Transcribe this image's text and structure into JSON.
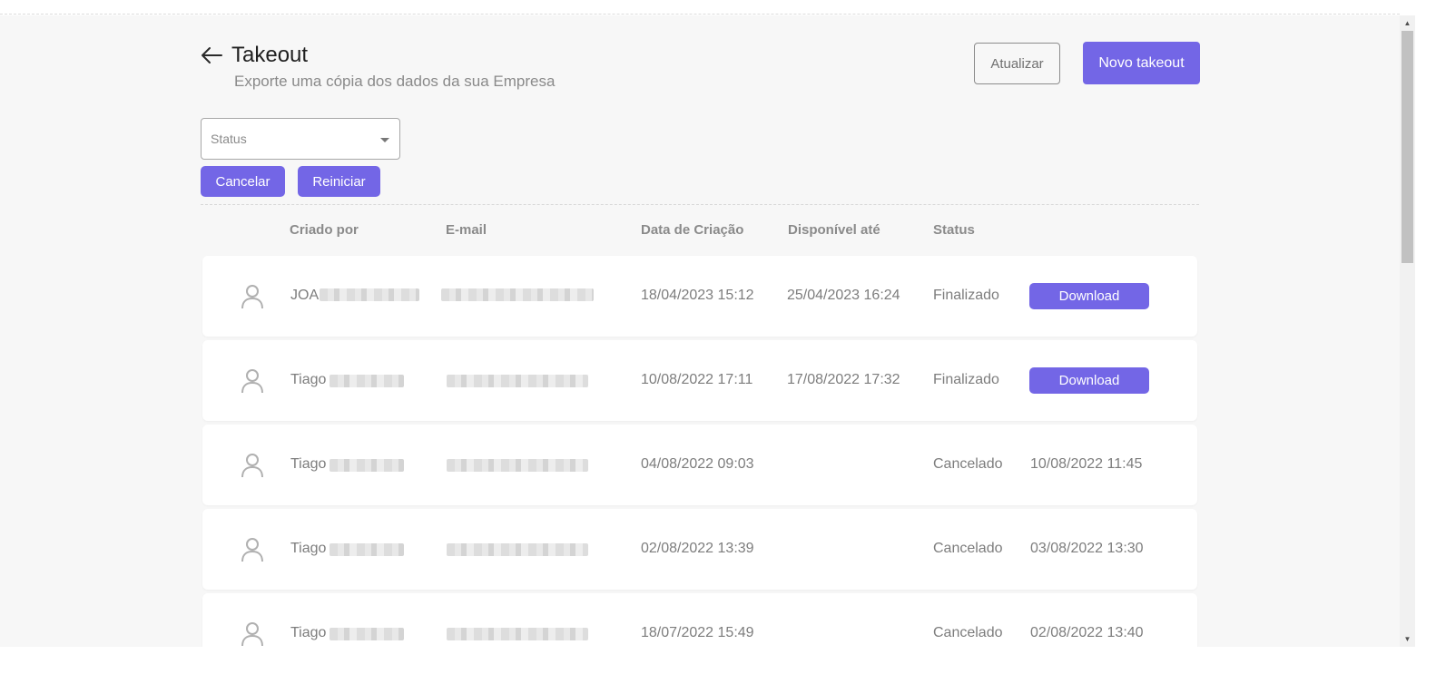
{
  "header": {
    "title": "Takeout",
    "subtitle": "Exporte uma cópia dos dados da sua Empresa"
  },
  "actions": {
    "refresh_label": "Atualizar",
    "new_label": "Novo takeout"
  },
  "filter": {
    "status_placeholder": "Status",
    "cancel_label": "Cancelar",
    "reset_label": "Reiniciar"
  },
  "columns": {
    "created_by": "Criado por",
    "email": "E-mail",
    "created_at": "Data de Criação",
    "available_until": "Disponível até",
    "status": "Status"
  },
  "rows": [
    {
      "name": "JOA",
      "created_at": "18/04/2023 15:12",
      "available_until": "25/04/2023 16:24",
      "status": "Finalizado",
      "action": "Download",
      "extra": ""
    },
    {
      "name": "Tiago",
      "created_at": "10/08/2022 17:11",
      "available_until": "17/08/2022 17:32",
      "status": "Finalizado",
      "action": "Download",
      "extra": ""
    },
    {
      "name": "Tiago",
      "created_at": "04/08/2022 09:03",
      "available_until": "",
      "status": "Cancelado",
      "action": "",
      "extra": "10/08/2022 11:45"
    },
    {
      "name": "Tiago",
      "created_at": "02/08/2022 13:39",
      "available_until": "",
      "status": "Cancelado",
      "action": "",
      "extra": "03/08/2022 13:30"
    },
    {
      "name": "Tiago",
      "created_at": "18/07/2022 15:49",
      "available_until": "",
      "status": "Cancelado",
      "action": "",
      "extra": "02/08/2022 13:40"
    }
  ],
  "colors": {
    "primary": "#7366e6",
    "background": "#f7f7f7"
  }
}
